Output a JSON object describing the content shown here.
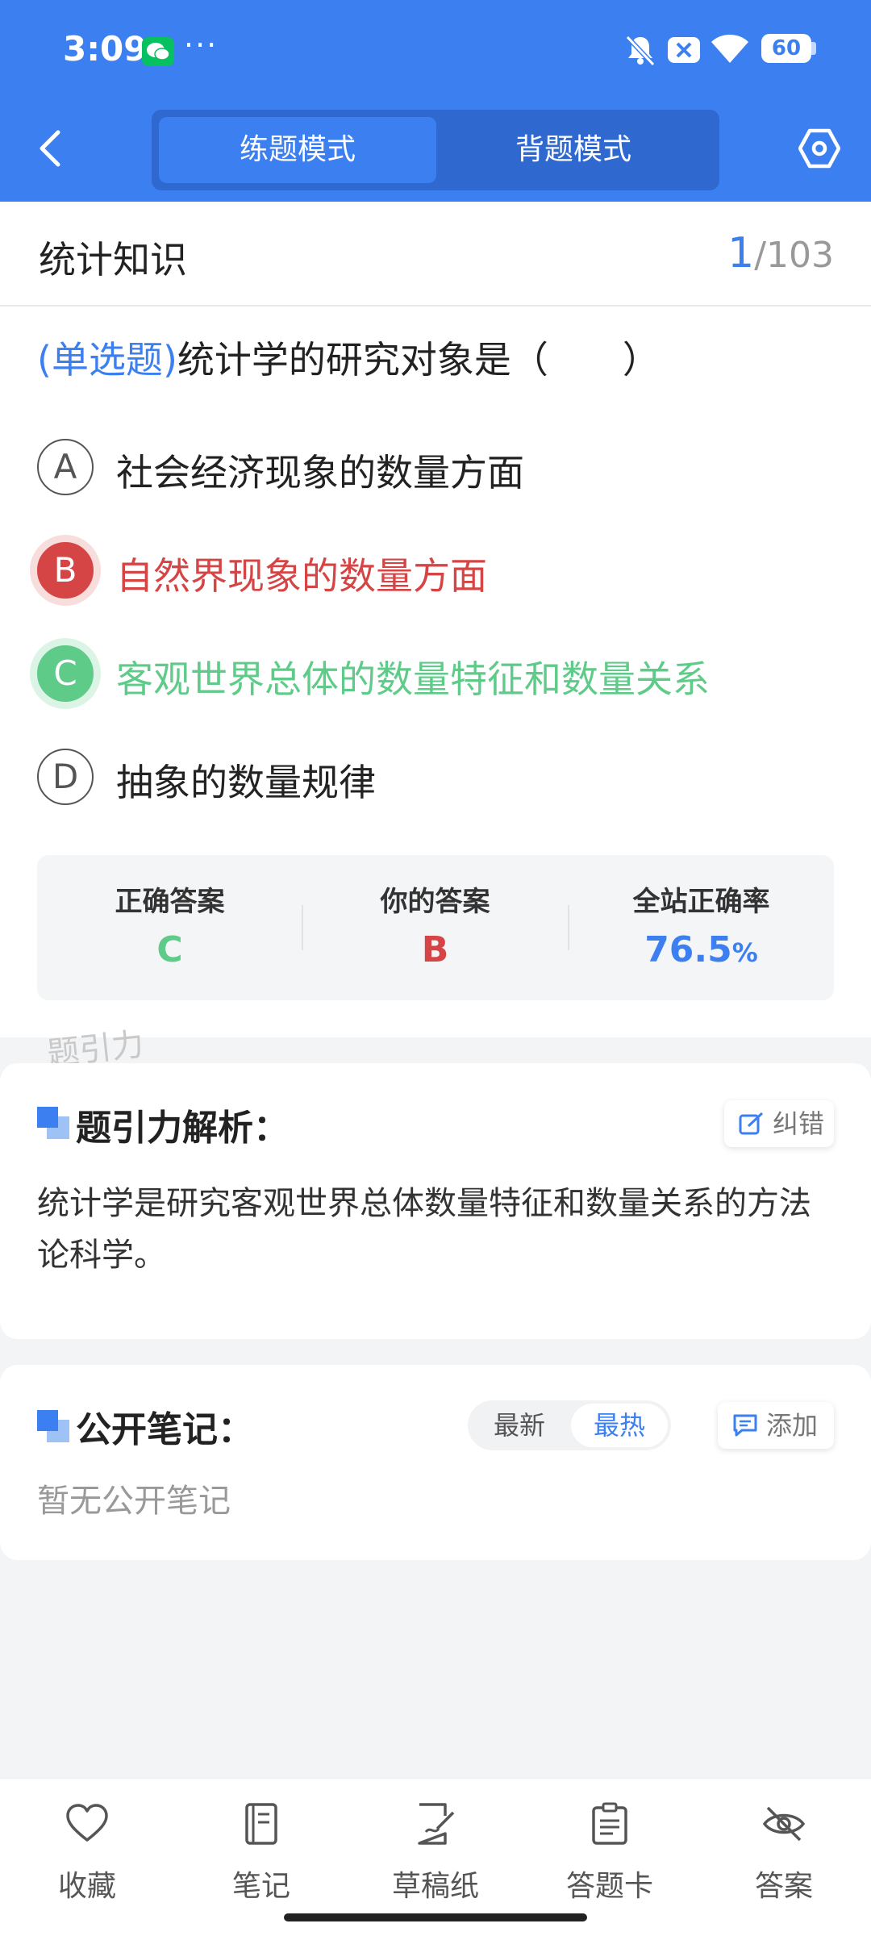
{
  "status_bar": {
    "time": "3:09",
    "dots": "···",
    "battery": "60"
  },
  "header": {
    "tabs": [
      {
        "label": "练题模式",
        "active": true
      },
      {
        "label": "背题模式",
        "active": false
      }
    ]
  },
  "topic": {
    "title": "统计知识",
    "current": "1",
    "total": "/103"
  },
  "question": {
    "type": "(单选题)",
    "text": "统计学的研究对象是（　　）"
  },
  "options": [
    {
      "letter": "A",
      "text": "社会经济现象的数量方面",
      "state": "normal"
    },
    {
      "letter": "B",
      "text": "自然界现象的数量方面",
      "state": "wrong"
    },
    {
      "letter": "C",
      "text": "客观世界总体的数量特征和数量关系",
      "state": "correct"
    },
    {
      "letter": "D",
      "text": "抽象的数量规律",
      "state": "normal"
    }
  ],
  "answer_summary": {
    "correct_label": "正确答案",
    "correct_value": "C",
    "yours_label": "你的答案",
    "yours_value": "B",
    "rate_label": "全站正确率",
    "rate_value": "76.5",
    "rate_unit": "%"
  },
  "watermark": "题引力",
  "analysis": {
    "title": "题引力解析：",
    "report_label": "纠错",
    "text": "统计学是研究客观世界总体数量特征和数量关系的方法论科学。"
  },
  "notes": {
    "title": "公开笔记：",
    "sort_newest": "最新",
    "sort_hottest": "最热",
    "add_label": "添加",
    "empty_text": "暂无公开笔记"
  },
  "bottom_tabs": [
    {
      "label": "收藏",
      "icon": "heart-icon"
    },
    {
      "label": "笔记",
      "icon": "notebook-icon"
    },
    {
      "label": "草稿纸",
      "icon": "draft-paper-icon"
    },
    {
      "label": "答题卡",
      "icon": "answer-card-icon"
    },
    {
      "label": "答案",
      "icon": "eye-off-icon"
    }
  ],
  "colors": {
    "primary": "#3b7ff0",
    "wrong": "#d64545",
    "correct": "#5fcb88",
    "background": "#f3f4f6"
  }
}
